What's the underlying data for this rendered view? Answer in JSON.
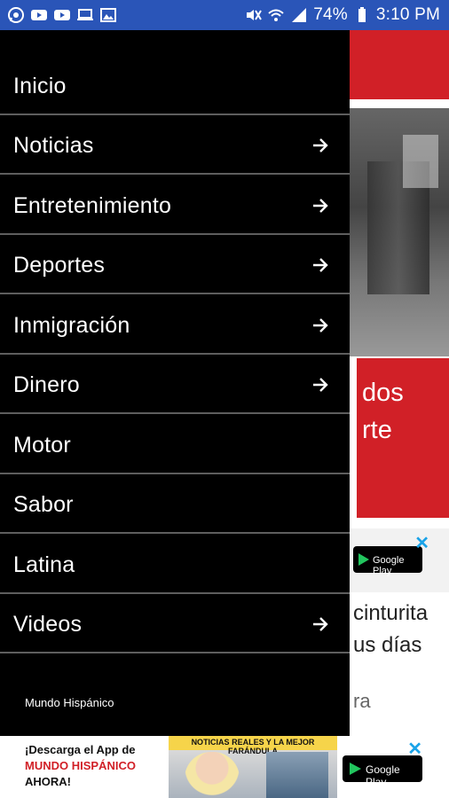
{
  "status_bar": {
    "battery_percent": "74%",
    "time": "3:10 PM",
    "left_icons": [
      "whatsapp-icon",
      "youtube-icon",
      "youtube-icon",
      "laptop-icon",
      "image-icon"
    ],
    "right_icons": [
      "mute-icon",
      "wifi-icon",
      "signal-icon",
      "battery-icon"
    ]
  },
  "drawer": {
    "items": [
      {
        "label": "Inicio",
        "has_arrow": false
      },
      {
        "label": "Noticias",
        "has_arrow": true
      },
      {
        "label": "Entretenimiento",
        "has_arrow": true
      },
      {
        "label": "Deportes",
        "has_arrow": true
      },
      {
        "label": "Inmigración",
        "has_arrow": true
      },
      {
        "label": "Dinero",
        "has_arrow": true
      },
      {
        "label": "Motor",
        "has_arrow": false
      },
      {
        "label": "Sabor",
        "has_arrow": false
      },
      {
        "label": "Latina",
        "has_arrow": false
      },
      {
        "label": "Videos",
        "has_arrow": true
      }
    ],
    "footer_brand": "Mundo Hispánico"
  },
  "background": {
    "red_card_text": "dos\nrte",
    "ad_badge": "Google Play",
    "story_text": "cinturita\nus días",
    "story_tail": "ra"
  },
  "banner": {
    "line1": "¡Descarga el App de",
    "line2": "MUNDO HISPÁNICO",
    "line3": "AHORA!",
    "strap": "NOTICIAS REALES Y LA MEJOR FARÁNDULA",
    "button": "Google Play"
  },
  "colors": {
    "status_bar": "#2a55b8",
    "drawer_bg": "#000000",
    "divider": "#5e5e5e",
    "brand_red": "#d12027"
  }
}
